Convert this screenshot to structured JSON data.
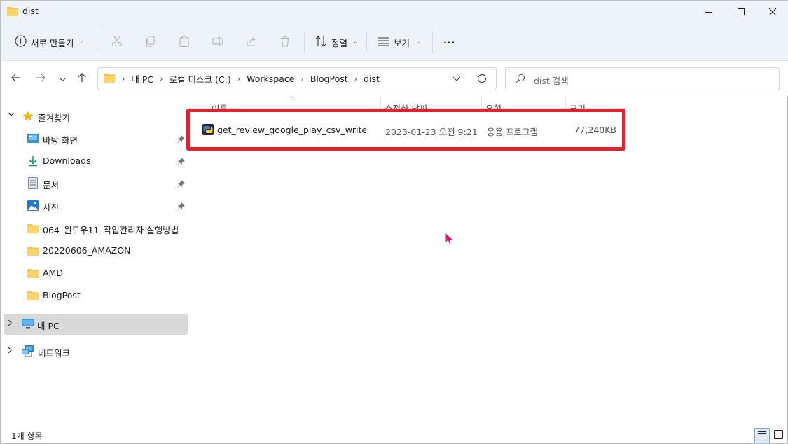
{
  "window": {
    "title": "dist"
  },
  "toolbar": {
    "new_label": "새로 만들기",
    "sort_label": "정렬",
    "view_label": "보기",
    "more_label": "···"
  },
  "address": {
    "crumbs": [
      "내 PC",
      "로컬 디스크 (C:)",
      "Workspace",
      "BlogPost",
      "dist"
    ]
  },
  "search": {
    "placeholder": "dist 검색"
  },
  "sidebar": {
    "quick_access": "즐겨찾기",
    "items": [
      {
        "label": "바탕 화면",
        "pinned": true
      },
      {
        "label": "Downloads",
        "pinned": true
      },
      {
        "label": "문서",
        "pinned": true
      },
      {
        "label": "사진",
        "pinned": true
      },
      {
        "label": "064_윈도우11_작업관리자 실행방법",
        "pinned": false
      },
      {
        "label": "20220606_AMAZON",
        "pinned": false
      },
      {
        "label": "AMD",
        "pinned": false
      },
      {
        "label": "BlogPost",
        "pinned": false
      }
    ],
    "this_pc": "내 PC",
    "network": "네트워크"
  },
  "columns": {
    "name": "이름",
    "date": "수정한 날짜",
    "type": "유형",
    "size": "크기"
  },
  "files": [
    {
      "name": "get_review_google_play_csv_write",
      "date": "2023-01-23 오전 9:21",
      "type": "응용 프로그램",
      "size": "77,240KB"
    }
  ],
  "status": {
    "count": "1개 항목"
  },
  "colors": {
    "highlight": "#e8202c",
    "folder": "#f5c24b",
    "accent": "#0067c0"
  }
}
